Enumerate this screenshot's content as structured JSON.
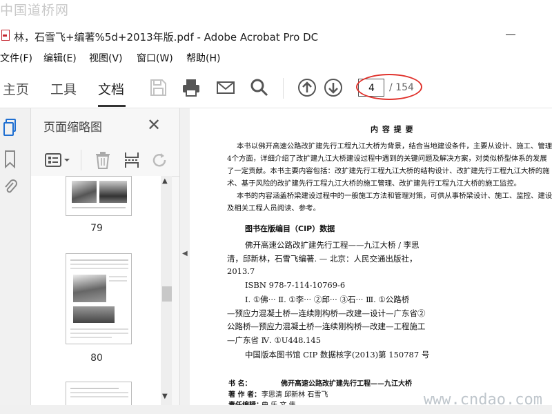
{
  "watermarks": {
    "top": "中国道桥网",
    "bottom": "www.cndao.com"
  },
  "window": {
    "title": "林，石雪飞+编著%5d+2013年版.pdf - Adobe Acrobat Pro DC"
  },
  "menu": [
    {
      "label": "文件(F)"
    },
    {
      "label": "编辑(E)"
    },
    {
      "label": "视图(V)"
    },
    {
      "label": "窗口(W)"
    },
    {
      "label": "帮助(H)"
    }
  ],
  "tabs": [
    {
      "label": "主页"
    },
    {
      "label": "工具"
    },
    {
      "label": "文档"
    }
  ],
  "toolbar": {
    "icons": [
      "save-icon",
      "print-icon",
      "email-icon",
      "search-icon",
      "page-up-icon",
      "page-down-icon"
    ],
    "page_current": "4",
    "page_total": "/ 154",
    "highlight_color": "#e0312b"
  },
  "sidebar_strip": {
    "icons": [
      "page-thumbnails-icon",
      "bookmark-icon",
      "attachment-icon"
    ]
  },
  "thumbnails": {
    "title": "页面缩略图",
    "tools": [
      "options-icon",
      "delete-icon",
      "insert-page-icon",
      "rotate-icon"
    ],
    "pages": [
      {
        "num": "79"
      },
      {
        "num": "80"
      }
    ]
  },
  "document": {
    "heading": "内 容 提 要",
    "summary": [
      "本书以佛开高速公路改扩建先行工程九江大桥为背景，结合当地建设条件，主要从设计、施工、管理、",
      "4个方面，详细介绍了改扩建九江大桥建设过程中遇到的关键问题及解决方案，对类似桥型体系的发展",
      "了一定贡献。本书主要内容包括：改扩建先行工程九江大桥的结构设计、改扩建先行工程九江大桥的施",
      "术、基于风险的改扩建先行工程九江大桥的施工管理、改扩建先行工程九江大桥的施工监控。",
      "本书的内容涵盖桥梁建设过程中的一般施工方法和管理对策，可供从事桥梁设计、施工、监控、建设",
      "及相关工程人员阅读、参考。"
    ],
    "cip_heading": "图书在版编目（CIP）数据",
    "cip_lines": [
      "佛开高速公路改扩建先行工程——九江大桥 / 李思",
      "清，邱新林，石雪飞编著. — 北京：人民交通出版社，",
      "2013.7",
      "ISBN 978-7-114-10769-6"
    ],
    "class_lines": [
      "Ⅰ. ①佛··· Ⅱ. ①李··· ②邱··· ③石··· Ⅲ. ①公路桥",
      "—预应力混凝土桥—连续刚构桥—改建—设计—广东省②",
      "公路桥—预应力混凝土桥—连续刚构桥—改建—工程施工",
      "—广东省  Ⅳ. ①U448.145"
    ],
    "cip_number": "中国版本图书馆 CIP 数据核字(2013)第 150787 号",
    "colophon": [
      {
        "label": "书      名：",
        "value": "佛开高速公路改扩建先行工程——九江大桥"
      },
      {
        "label": "著  作  者：",
        "value": "李思清   邱新林   石雪飞"
      },
      {
        "label": "责任编辑：",
        "value": "曲   乐   文   伟"
      }
    ]
  }
}
